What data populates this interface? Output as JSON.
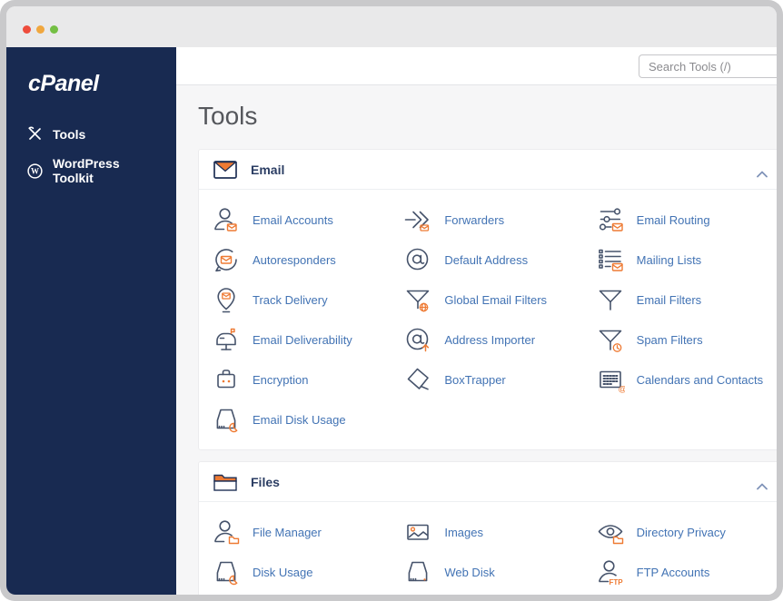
{
  "colors": {
    "sidebar-navy": "#182a51",
    "link-blue": "#4273b4",
    "accent-orange": "#ee7a33",
    "icon-slate": "#46536b",
    "section-title-navy": "#2b3d63",
    "frame-gray": "#c9c9cb",
    "traffic-red": "#ee4c3c",
    "traffic-yellow": "#f0a73e",
    "traffic-green": "#74bf44"
  },
  "sidebar": {
    "logo": "cPanel",
    "items": [
      {
        "label": "Tools",
        "icon": "tools-icon"
      },
      {
        "label": "WordPress Toolkit",
        "icon": "wordpress-icon"
      }
    ]
  },
  "header": {
    "search_placeholder": "Search Tools (/)"
  },
  "page": {
    "title": "Tools"
  },
  "sections": [
    {
      "title": "Email",
      "icon": "email-section-icon",
      "collapse_icon": "chevron-up-icon",
      "items": [
        {
          "label": "Email Accounts",
          "icon": "email-accounts-icon"
        },
        {
          "label": "Forwarders",
          "icon": "forwarders-icon"
        },
        {
          "label": "Email Routing",
          "icon": "email-routing-icon"
        },
        {
          "label": "Autoresponders",
          "icon": "autoresponders-icon"
        },
        {
          "label": "Default Address",
          "icon": "default-address-icon"
        },
        {
          "label": "Mailing Lists",
          "icon": "mailing-lists-icon"
        },
        {
          "label": "Track Delivery",
          "icon": "track-delivery-icon"
        },
        {
          "label": "Global Email Filters",
          "icon": "global-email-filters-icon"
        },
        {
          "label": "Email Filters",
          "icon": "email-filters-icon"
        },
        {
          "label": "Email Deliverability",
          "icon": "email-deliverability-icon"
        },
        {
          "label": "Address Importer",
          "icon": "address-importer-icon"
        },
        {
          "label": "Spam Filters",
          "icon": "spam-filters-icon"
        },
        {
          "label": "Encryption",
          "icon": "encryption-icon"
        },
        {
          "label": "BoxTrapper",
          "icon": "boxtrapper-icon"
        },
        {
          "label": "Calendars and Contacts",
          "icon": "calendars-contacts-icon"
        },
        {
          "label": "Email Disk Usage",
          "icon": "email-disk-usage-icon"
        }
      ]
    },
    {
      "title": "Files",
      "icon": "files-section-icon",
      "collapse_icon": "chevron-up-icon",
      "items": [
        {
          "label": "File Manager",
          "icon": "file-manager-icon"
        },
        {
          "label": "Images",
          "icon": "images-icon"
        },
        {
          "label": "Directory Privacy",
          "icon": "directory-privacy-icon"
        },
        {
          "label": "Disk Usage",
          "icon": "disk-usage-icon"
        },
        {
          "label": "Web Disk",
          "icon": "web-disk-icon"
        },
        {
          "label": "FTP Accounts",
          "icon": "ftp-accounts-icon"
        }
      ]
    }
  ]
}
